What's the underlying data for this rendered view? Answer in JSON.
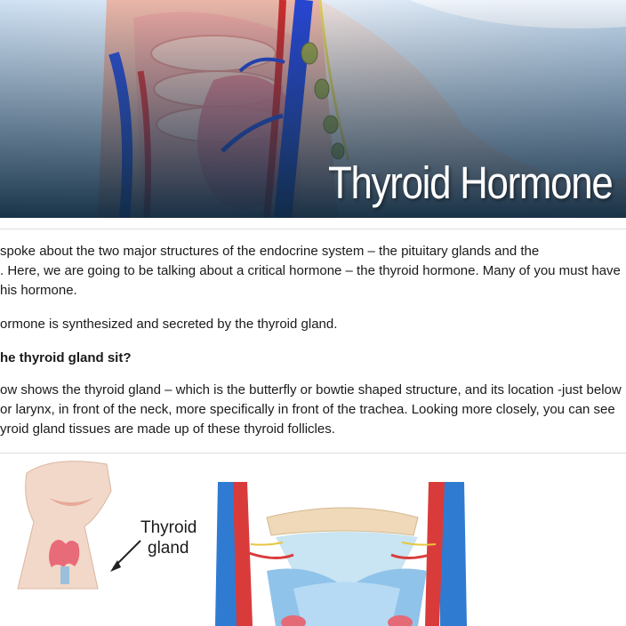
{
  "hero": {
    "title": "Thyroid Hormone",
    "colors": {
      "overlay": "#17344d",
      "title": "#ffffff"
    }
  },
  "article": {
    "paragraphs": [
      {
        "lines": [
          " spoke about the two major structures of the endocrine system – the pituitary glands and the",
          ". Here, we are going to be talking about a critical hormone – the thyroid hormone. Many of you must have",
          "his hormone."
        ]
      },
      {
        "lines": [
          "ormone is synthesized and secreted by the thyroid gland."
        ]
      },
      {
        "lines": [
          "he thyroid gland sit?"
        ],
        "bold": true
      },
      {
        "lines": [
          "ow shows the thyroid gland – which is the butterfly or bowtie shaped structure, and its location -just below",
          "or larynx, in front of the neck, more specifically in front of the trachea. Looking more closely, you can see",
          "yroid gland tissues are made up of these thyroid follicles."
        ]
      }
    ]
  },
  "figure": {
    "label_line1": "Thyroid",
    "label_line2": "gland"
  }
}
